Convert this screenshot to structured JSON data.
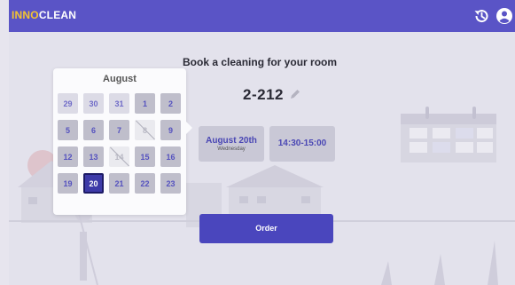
{
  "brand": {
    "part1": "INNO",
    "part2": "CLEAN"
  },
  "topbar": {
    "history_icon": "history-icon",
    "account_icon": "account-icon"
  },
  "main": {
    "heading": "Book a cleaning for your room",
    "room": "2-212",
    "edit_icon": "pencil-icon",
    "date_chip": {
      "label": "August 20th",
      "weekday": "Wednesday"
    },
    "time_chip": {
      "label": "14:30-15:00"
    },
    "order_label": "Order"
  },
  "calendar": {
    "month": "August",
    "days": [
      {
        "label": "29",
        "state": "out"
      },
      {
        "label": "30",
        "state": "out"
      },
      {
        "label": "31",
        "state": "out"
      },
      {
        "label": "1",
        "state": "in"
      },
      {
        "label": "2",
        "state": "in"
      },
      {
        "label": "5",
        "state": "in"
      },
      {
        "label": "6",
        "state": "in"
      },
      {
        "label": "7",
        "state": "in"
      },
      {
        "label": "8",
        "state": "dis"
      },
      {
        "label": "9",
        "state": "in"
      },
      {
        "label": "12",
        "state": "in"
      },
      {
        "label": "13",
        "state": "in"
      },
      {
        "label": "14",
        "state": "dis"
      },
      {
        "label": "15",
        "state": "in"
      },
      {
        "label": "16",
        "state": "in"
      },
      {
        "label": "19",
        "state": "in"
      },
      {
        "label": "20",
        "state": "sel"
      },
      {
        "label": "21",
        "state": "in"
      },
      {
        "label": "22",
        "state": "in"
      },
      {
        "label": "23",
        "state": "in"
      }
    ]
  },
  "colors": {
    "primary": "#5a54c6",
    "brand_accent": "#f4c430",
    "selected": "#3d3aa8"
  }
}
